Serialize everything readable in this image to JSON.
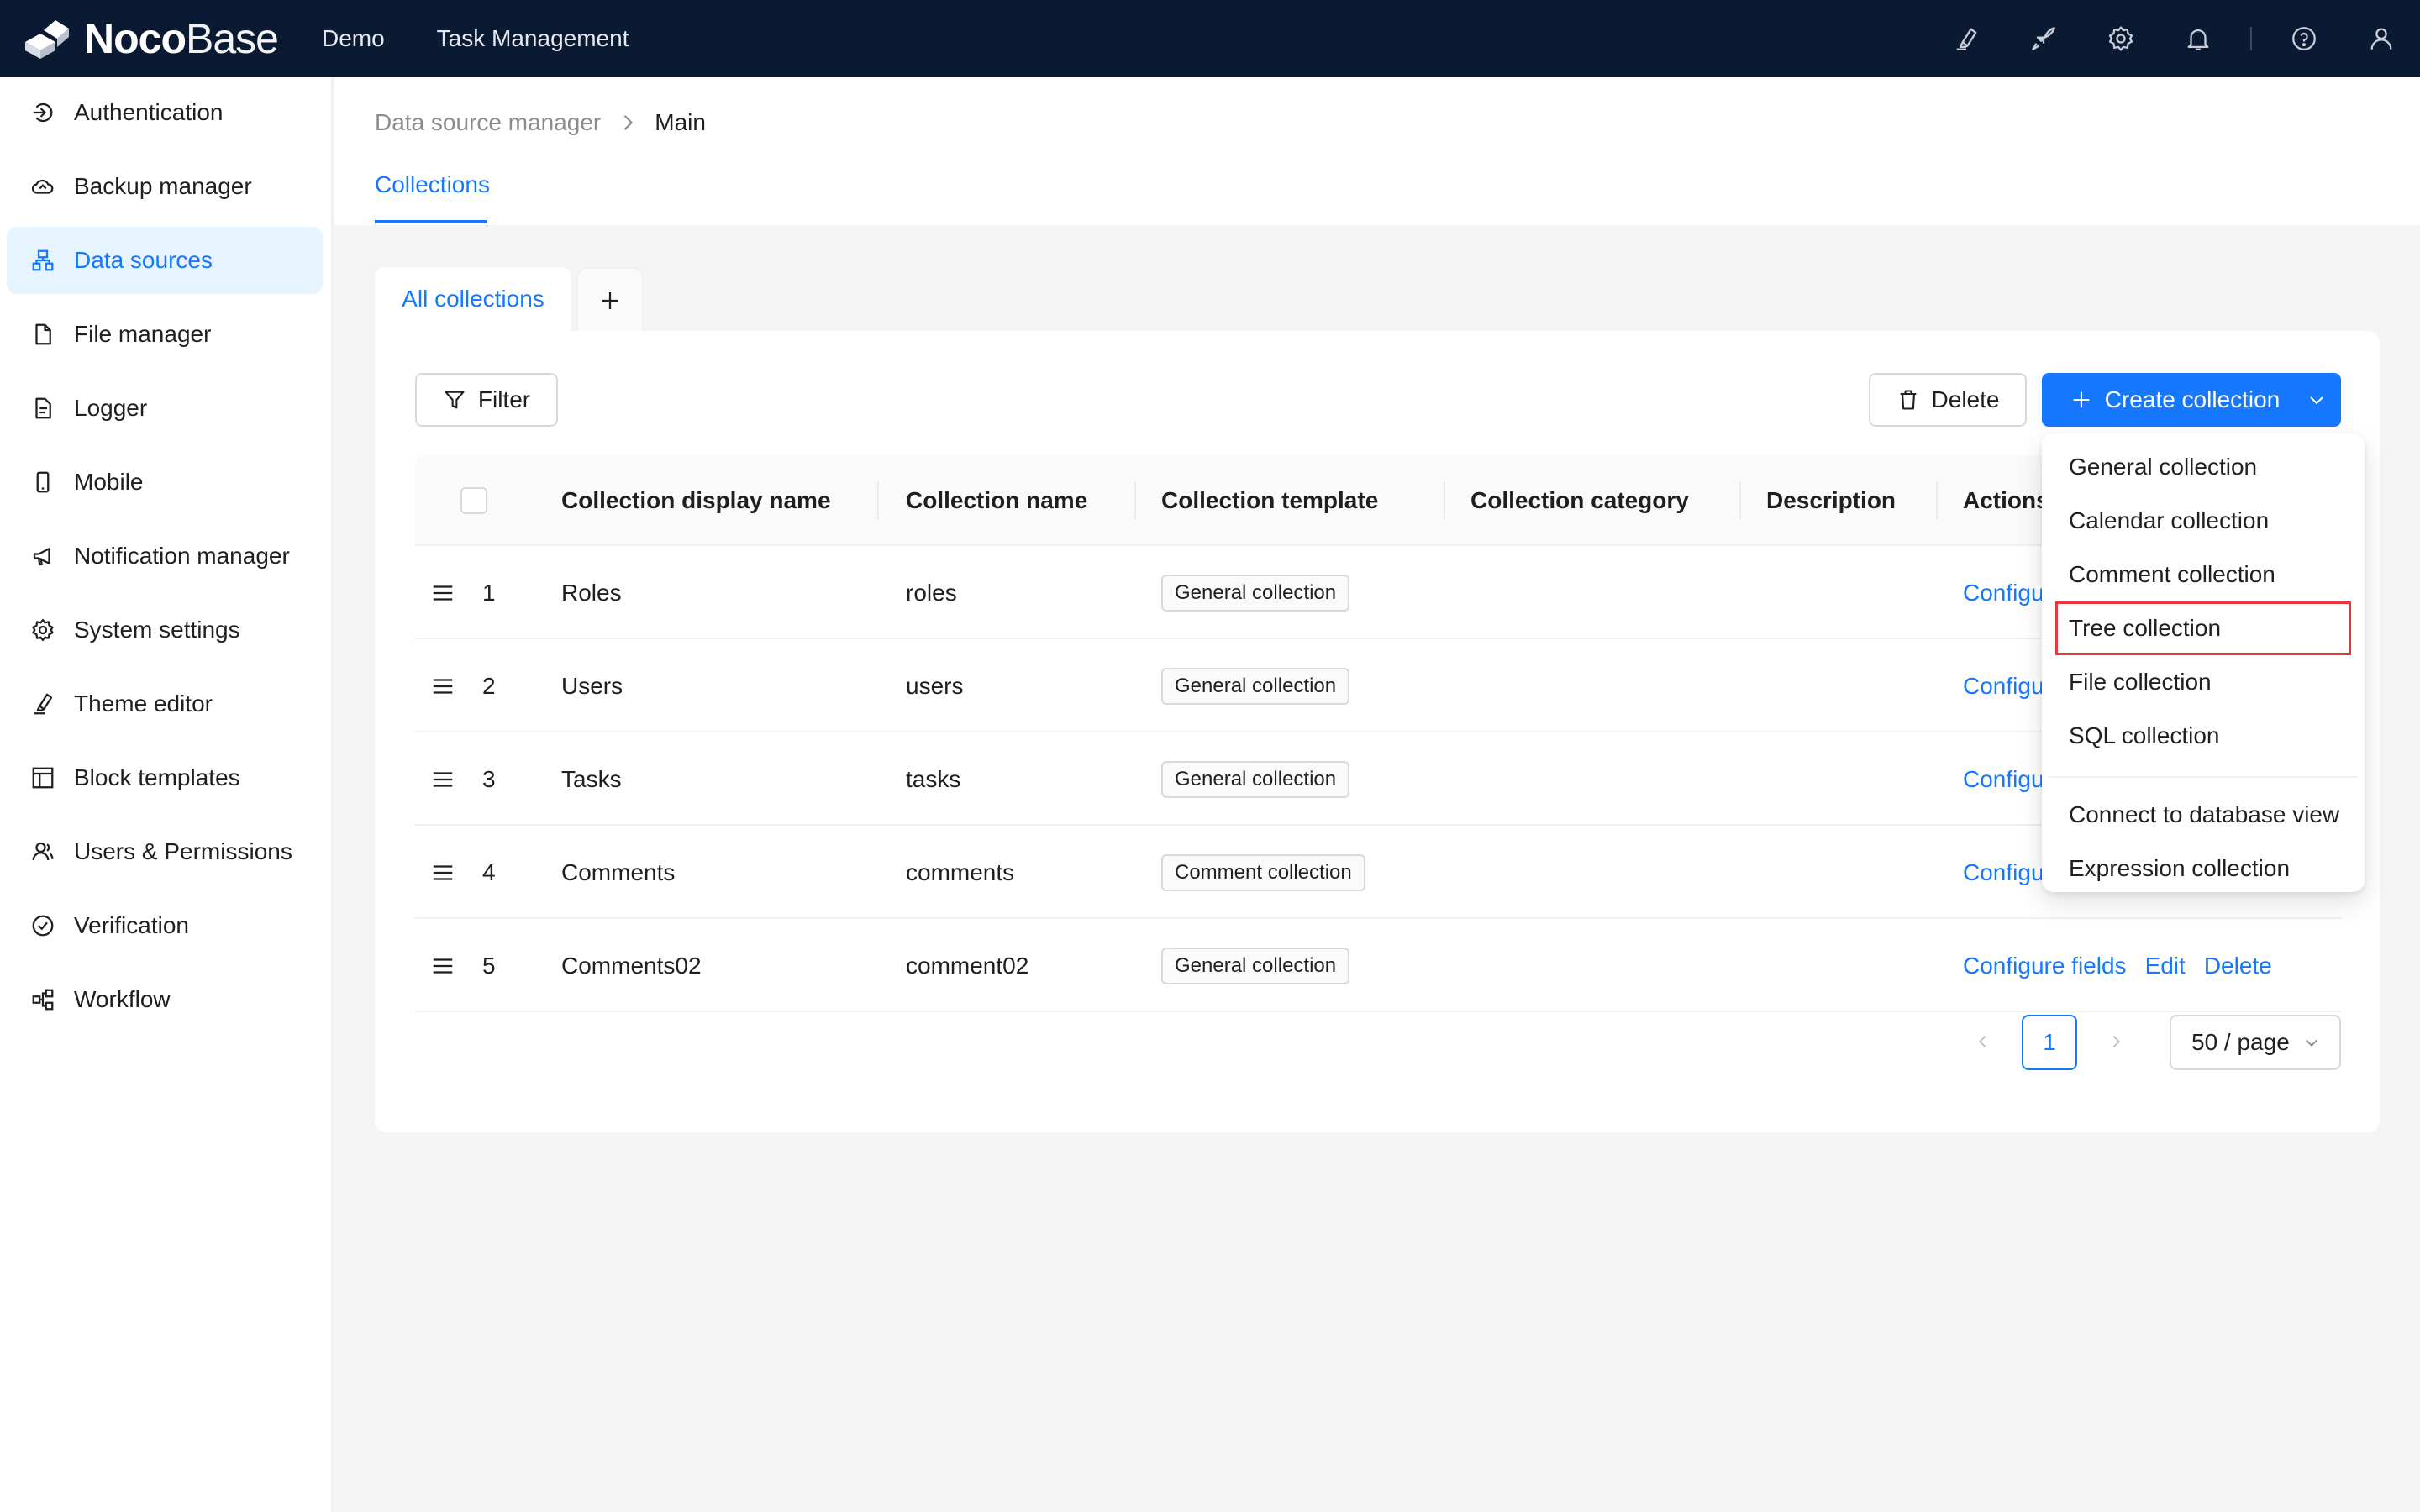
{
  "header": {
    "logo_noco": "Noco",
    "logo_base": "Base",
    "nav": [
      "Demo",
      "Task Management"
    ],
    "icons": [
      "highlighter-icon",
      "rocket-icon",
      "gear-icon",
      "bell-icon",
      "help-icon",
      "user-icon"
    ]
  },
  "sidebar": {
    "items": [
      {
        "label": "Authentication",
        "icon": "login-icon"
      },
      {
        "label": "Backup manager",
        "icon": "cloud-backup-icon"
      },
      {
        "label": "Data sources",
        "icon": "data-sources-icon",
        "active": true
      },
      {
        "label": "File manager",
        "icon": "file-icon"
      },
      {
        "label": "Logger",
        "icon": "file-text-icon"
      },
      {
        "label": "Mobile",
        "icon": "mobile-icon"
      },
      {
        "label": "Notification manager",
        "icon": "megaphone-icon"
      },
      {
        "label": "System settings",
        "icon": "gear-icon"
      },
      {
        "label": "Theme editor",
        "icon": "brush-icon"
      },
      {
        "label": "Block templates",
        "icon": "layout-icon"
      },
      {
        "label": "Users & Permissions",
        "icon": "users-icon"
      },
      {
        "label": "Verification",
        "icon": "check-circle-icon"
      },
      {
        "label": "Workflow",
        "icon": "workflow-icon"
      }
    ]
  },
  "breadcrumb": {
    "parent": "Data source manager",
    "current": "Main"
  },
  "page_tab": "Collections",
  "collection_tabs": {
    "active": "All collections"
  },
  "toolbar": {
    "filter_label": "Filter",
    "delete_label": "Delete",
    "create_label": "Create collection"
  },
  "table": {
    "columns": [
      "Collection display name",
      "Collection name",
      "Collection template",
      "Collection category",
      "Description",
      "Actions"
    ],
    "rows": [
      {
        "index": "1",
        "display_name": "Roles",
        "name": "roles",
        "template": "General collection",
        "actions": [
          "Configure fields"
        ]
      },
      {
        "index": "2",
        "display_name": "Users",
        "name": "users",
        "template": "General collection",
        "actions": [
          "Configure fields"
        ]
      },
      {
        "index": "3",
        "display_name": "Tasks",
        "name": "tasks",
        "template": "General collection",
        "actions": [
          "Configure fields"
        ]
      },
      {
        "index": "4",
        "display_name": "Comments",
        "name": "comments",
        "template": "Comment collection",
        "actions": [
          "Configure fields"
        ]
      },
      {
        "index": "5",
        "display_name": "Comments02",
        "name": "comment02",
        "template": "General collection",
        "actions": [
          "Configure fields",
          "Edit",
          "Delete"
        ]
      }
    ]
  },
  "pagination": {
    "current_page": "1",
    "page_size": "50 / page"
  },
  "create_menu": {
    "items": [
      "General collection",
      "Calendar collection",
      "Comment collection",
      "Tree collection",
      "File collection",
      "SQL collection"
    ],
    "extra_items": [
      "Connect to database view",
      "Expression collection"
    ],
    "highlighted": "Tree collection",
    "highlight_color": "#e5383b"
  },
  "colors": {
    "primary": "#1677ff",
    "topbar": "#0b1a33",
    "active_bg": "#e6f4ff"
  }
}
